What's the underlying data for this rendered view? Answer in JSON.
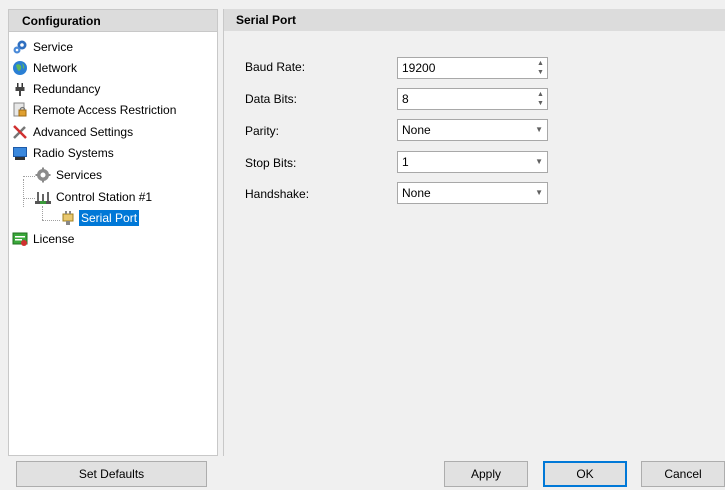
{
  "tree": {
    "header": "Configuration",
    "items": [
      {
        "label": "Service",
        "icon": "gear-blue-icon"
      },
      {
        "label": "Network",
        "icon": "globe-icon"
      },
      {
        "label": "Redundancy",
        "icon": "plug-icon"
      },
      {
        "label": "Remote Access Restriction",
        "icon": "lock-document-icon"
      },
      {
        "label": "Advanced Settings",
        "icon": "tools-icon"
      },
      {
        "label": "Radio Systems",
        "icon": "radio-systems-icon"
      },
      {
        "label": "Services",
        "icon": "gear-gray-icon"
      },
      {
        "label": "Control Station #1",
        "icon": "control-station-icon"
      },
      {
        "label": "Serial Port",
        "icon": "serial-port-icon",
        "selected": true
      },
      {
        "label": "License",
        "icon": "license-icon"
      }
    ]
  },
  "main": {
    "header": "Serial Port",
    "fields": {
      "baud_rate": {
        "label": "Baud Rate:",
        "value": "19200",
        "type": "spinner"
      },
      "data_bits": {
        "label": "Data Bits:",
        "value": "8",
        "type": "spinner"
      },
      "parity": {
        "label": "Parity:",
        "value": "None",
        "type": "dropdown"
      },
      "stop_bits": {
        "label": "Stop Bits:",
        "value": "1",
        "type": "dropdown"
      },
      "handshake": {
        "label": "Handshake:",
        "value": "None",
        "type": "dropdown"
      }
    }
  },
  "buttons": {
    "set_defaults": "Set Defaults",
    "apply": "Apply",
    "ok": "OK",
    "cancel": "Cancel"
  },
  "colors": {
    "selection": "#0078d7",
    "header_bg": "#dcdcdc",
    "window_bg": "#f0f0f0"
  }
}
